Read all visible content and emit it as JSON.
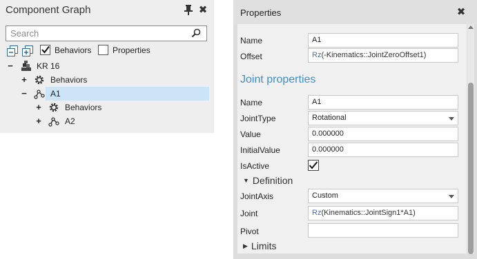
{
  "component_graph": {
    "title": "Component Graph",
    "pin_icon": "pin-icon",
    "close_icon": "close-icon",
    "search": {
      "placeholder": "Search",
      "value": ""
    },
    "toolbar": {
      "behaviors_label": "Behaviors",
      "behaviors_checked": true,
      "properties_label": "Properties",
      "properties_checked": false
    },
    "tree": [
      {
        "toggle": "−",
        "icon": "robot-icon",
        "label": "KR 16",
        "level": 0
      },
      {
        "toggle": "+",
        "icon": "gear-icon",
        "label": "Behaviors",
        "level": 1
      },
      {
        "toggle": "−",
        "icon": "link-icon",
        "label": "A1",
        "level": 1,
        "selected": true
      },
      {
        "toggle": "+",
        "icon": "gear-icon",
        "label": "Behaviors",
        "level": 2
      },
      {
        "toggle": "+",
        "icon": "link-icon",
        "label": "A2",
        "level": 2
      }
    ]
  },
  "properties": {
    "title": "Properties",
    "close_icon": "close-icon",
    "name_label": "Name",
    "name_value": "A1",
    "offset_label": "Offset",
    "offset_prefix": "Rz",
    "offset_rest": "(-Kinematics::JointZeroOffset1)",
    "joint_properties_title": "Joint properties",
    "joint": {
      "name_label": "Name",
      "name_value": "A1",
      "jointtype_label": "JointType",
      "jointtype_value": "Rotational",
      "value_label": "Value",
      "value_value": "0.000000",
      "initialvalue_label": "InitialValue",
      "initialvalue_value": "0.000000",
      "isactive_label": "IsActive",
      "isactive_checked": true
    },
    "definition": {
      "header": "Definition",
      "expanded": true,
      "jointaxis_label": "JointAxis",
      "jointaxis_value": "Custom",
      "joint_label": "Joint",
      "joint_prefix": "Rz",
      "joint_rest": "(Kinematics::JointSign1*A1)",
      "pivot_label": "Pivot",
      "pivot_value": ""
    },
    "limits": {
      "header": "Limits",
      "expanded": false
    },
    "colors": {
      "accent": "#3f8fc9",
      "selection": "#cce4f7",
      "expression": "#4a6fb5"
    }
  }
}
